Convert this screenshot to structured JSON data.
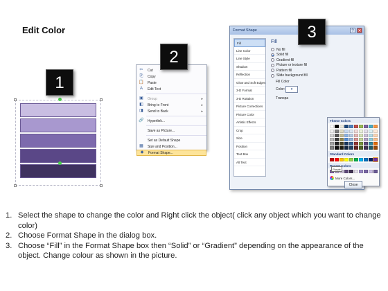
{
  "title": "Edit Color",
  "badges": [
    "1",
    "2",
    "3"
  ],
  "context_menu": {
    "items": [
      {
        "icon": "scissors-icon",
        "glyph": "✂",
        "label": "Cut",
        "disabled": false,
        "submenu": false
      },
      {
        "icon": "copy-icon",
        "glyph": "⎘",
        "label": "Copy",
        "disabled": false,
        "submenu": false
      },
      {
        "icon": "paste-icon",
        "glyph": "📋",
        "label": "Paste",
        "disabled": false,
        "submenu": false
      },
      {
        "icon": "edit-text-icon",
        "glyph": "A",
        "label": "Edit Text",
        "disabled": false,
        "submenu": false,
        "sep_after": true
      },
      {
        "icon": "group-icon",
        "glyph": "▣",
        "label": "Group",
        "disabled": true,
        "submenu": true
      },
      {
        "icon": "bring-front-icon",
        "glyph": "◧",
        "label": "Bring to Front",
        "disabled": false,
        "submenu": true
      },
      {
        "icon": "send-back-icon",
        "glyph": "◨",
        "label": "Send to Back",
        "disabled": false,
        "submenu": true,
        "sep_after": true
      },
      {
        "icon": "hyperlink-icon",
        "glyph": "🔗",
        "label": "Hyperlink...",
        "disabled": false,
        "submenu": false,
        "sep_after": true
      },
      {
        "icon": "save-picture-icon",
        "glyph": "",
        "label": "Save as Picture...",
        "disabled": false,
        "submenu": false,
        "sep_after": true
      },
      {
        "icon": "default-shape-icon",
        "glyph": "",
        "label": "Set as Default Shape",
        "disabled": false,
        "submenu": false
      },
      {
        "icon": "size-position-icon",
        "glyph": "▦",
        "label": "Size and Position...",
        "disabled": false,
        "submenu": false
      },
      {
        "icon": "format-shape-icon",
        "glyph": "◆",
        "label": "Format Shape...",
        "disabled": false,
        "submenu": false,
        "highlight": true
      }
    ]
  },
  "dialog": {
    "title": "Format Shape",
    "help": "?",
    "close_glyph": "✕",
    "nav": [
      "Fill",
      "Line Color",
      "Line Style",
      "Shadow",
      "Reflection",
      "Glow and Soft Edges",
      "3-D Format",
      "3-D Rotation",
      "Picture Corrections",
      "Picture Color",
      "Artistic Effects",
      "Crop",
      "Size",
      "Position",
      "Text Box",
      "Alt Text"
    ],
    "active_nav": "Fill",
    "fill_heading": "Fill",
    "options": [
      {
        "label": "No fill",
        "checked": false
      },
      {
        "label": "Solid fill",
        "checked": true
      },
      {
        "label": "Gradient fill",
        "checked": false
      },
      {
        "label": "Picture or texture fill",
        "checked": false
      },
      {
        "label": "Pattern fill",
        "checked": false
      },
      {
        "label": "Slide background fill",
        "checked": false
      }
    ],
    "fill_color_label": "Fill Color",
    "color_label": "Color:",
    "transparency_label": "Transpa",
    "close_button": "Close"
  },
  "picker": {
    "theme_label": "Theme Colors",
    "standard_label": "Standard Colors",
    "recent_label": "Recent Colors",
    "more_colors": "More Colors...",
    "tooltip": "Purple",
    "theme_top": [
      "#ffffff",
      "#000000",
      "#eeece1",
      "#1f497d",
      "#4f81bd",
      "#c0504d",
      "#9bbb59",
      "#8064a2",
      "#4bacc6",
      "#f79646"
    ],
    "theme_shades": [
      [
        "#f2f2f2",
        "#7f7f7f",
        "#ddd9c3",
        "#c6d9f0",
        "#dbe5f1",
        "#f2dcdb",
        "#ebf1dd",
        "#e5e0ec",
        "#dbeef3",
        "#fdeada"
      ],
      [
        "#d8d8d8",
        "#595959",
        "#c4bd97",
        "#8db3e2",
        "#b8cce4",
        "#e5b9b7",
        "#d7e3bc",
        "#ccc1d9",
        "#b7dde8",
        "#fbd5b5"
      ],
      [
        "#bfbfbf",
        "#3f3f3f",
        "#938953",
        "#548dd4",
        "#95b3d7",
        "#d99694",
        "#c3d69b",
        "#b2a2c7",
        "#92cddc",
        "#fac08f"
      ],
      [
        "#a5a5a5",
        "#262626",
        "#494429",
        "#17365d",
        "#366092",
        "#953734",
        "#76923c",
        "#5f497a",
        "#31859b",
        "#e36c09"
      ],
      [
        "#7f7f7f",
        "#0c0c0c",
        "#1d1b10",
        "#0f243e",
        "#244061",
        "#632423",
        "#4f6128",
        "#3f3151",
        "#205867",
        "#974806"
      ]
    ],
    "standard": [
      "#c00000",
      "#ff0000",
      "#ffc000",
      "#ffff00",
      "#92d050",
      "#00b050",
      "#00b0f0",
      "#0070c0",
      "#002060",
      "#7030a0"
    ],
    "recent": [
      "#8064a2",
      "#b2a2c7",
      "#ccc1d9",
      "#5f497a",
      "#3f3151",
      "#e5e0ec",
      "#9b8ac4",
      "#7b68a6",
      "#c9bee2",
      "#6a5a96"
    ],
    "selected_standard_index": 9
  },
  "instructions": [
    {
      "num": "1.",
      "text": "Select the shape to change the color and Right click the object( click any object which you want to change color)"
    },
    {
      "num": "2.",
      "text": "Choose Format Shape in the dialog box."
    },
    {
      "num": "3.",
      "text": "Choose “Fill” in the Format Shape box then “Solid” or “Gradient” depending on the appearance of the object. Change colour as shown in the picture."
    }
  ]
}
